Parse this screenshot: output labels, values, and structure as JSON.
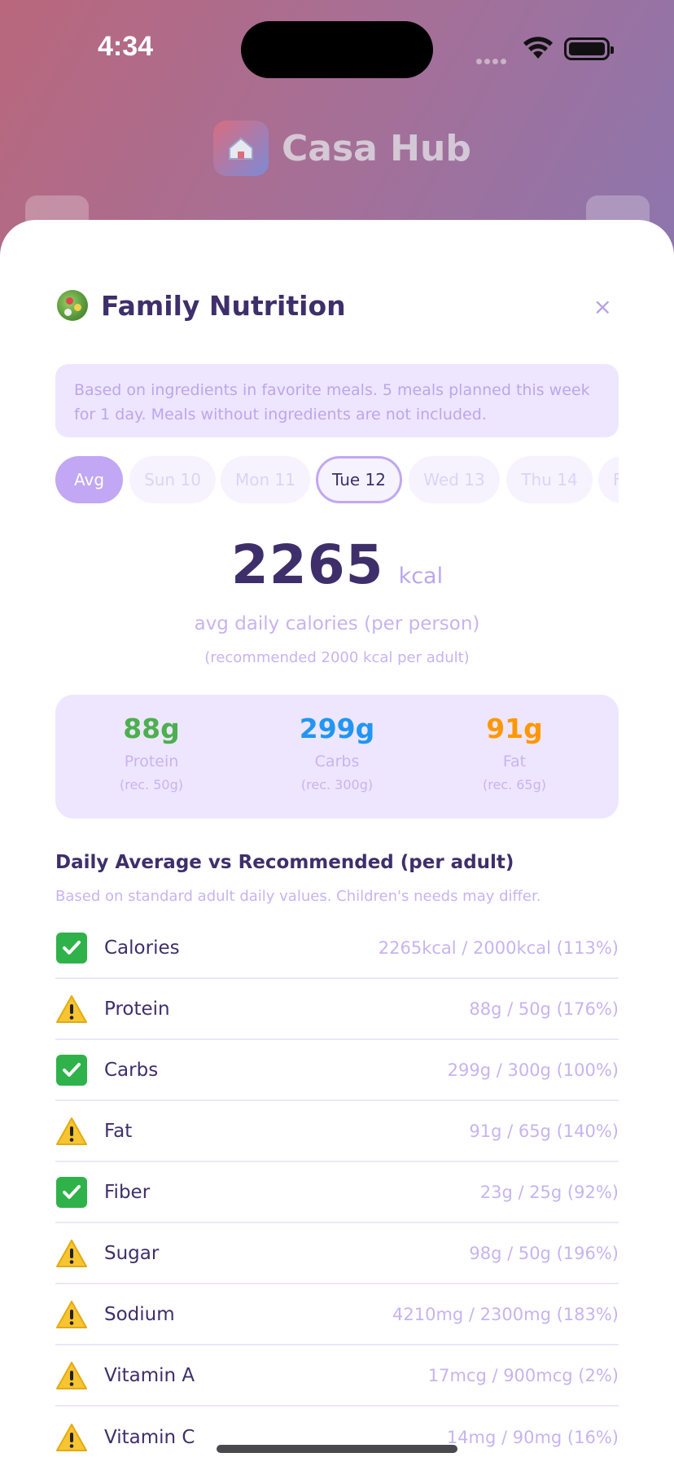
{
  "status_bar": {
    "time": "4:34"
  },
  "background_app": {
    "title": "Casa Hub"
  },
  "sheet": {
    "title": "Family Nutrition",
    "close_label": "×",
    "info": "Based on ingredients in favorite meals. 5 meals planned this week for 1 day. Meals without ingredients are not included.",
    "days": [
      "Avg",
      "Sun 10",
      "Mon 11",
      "Tue 12",
      "Wed 13",
      "Thu 14",
      "F"
    ],
    "calories": {
      "value": "2265",
      "unit": "kcal",
      "label": "avg daily calories (per person)",
      "recommended": "(recommended 2000 kcal per adult)"
    },
    "macros": [
      {
        "value": "88g",
        "label": "Protein",
        "rec": "(rec. 50g)",
        "color": "#4caf50"
      },
      {
        "value": "299g",
        "label": "Carbs",
        "rec": "(rec. 300g)",
        "color": "#2196f3"
      },
      {
        "value": "91g",
        "label": "Fat",
        "rec": "(rec. 65g)",
        "color": "#ff9800"
      }
    ],
    "section_title": "Daily Average vs Recommended (per adult)",
    "section_subtitle": "Based on standard adult daily values. Children's needs may differ.",
    "nutrients": [
      {
        "name": "Calories",
        "value": "2265kcal / 2000kcal (113%)",
        "status": "ok"
      },
      {
        "name": "Protein",
        "value": "88g / 50g (176%)",
        "status": "warning"
      },
      {
        "name": "Carbs",
        "value": "299g / 300g (100%)",
        "status": "ok"
      },
      {
        "name": "Fat",
        "value": "91g / 65g (140%)",
        "status": "warning"
      },
      {
        "name": "Fiber",
        "value": "23g / 25g (92%)",
        "status": "ok"
      },
      {
        "name": "Sugar",
        "value": "98g / 50g (196%)",
        "status": "warning"
      },
      {
        "name": "Sodium",
        "value": "4210mg / 2300mg (183%)",
        "status": "warning"
      },
      {
        "name": "Vitamin A",
        "value": "17mcg / 900mcg (2%)",
        "status": "warning"
      },
      {
        "name": "Vitamin C",
        "value": "14mg / 90mg (16%)",
        "status": "warning"
      }
    ]
  }
}
